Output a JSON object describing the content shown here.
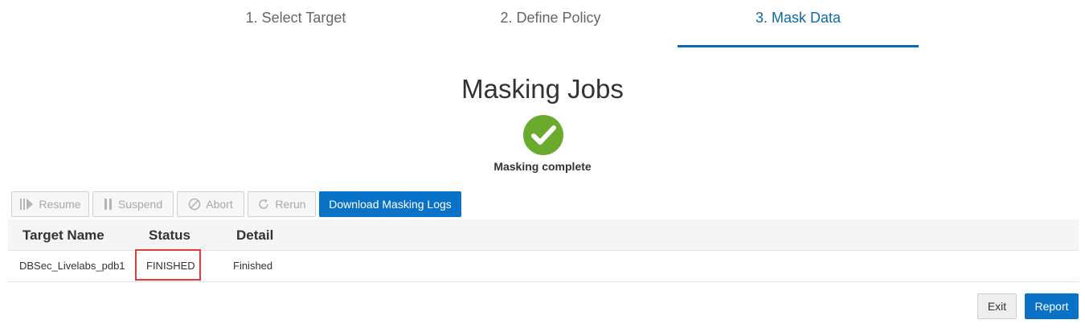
{
  "steps": [
    {
      "label": "1. Select Target"
    },
    {
      "label": "2. Define Policy"
    },
    {
      "label": "3. Mask Data"
    }
  ],
  "title": "Masking Jobs",
  "status_icon": "check-circle-icon",
  "status_text": "Masking complete",
  "toolbar": {
    "resume": "Resume",
    "suspend": "Suspend",
    "abort": "Abort",
    "rerun": "Rerun",
    "download": "Download Masking Logs"
  },
  "table": {
    "headers": [
      "Target Name",
      "Status",
      "Detail"
    ],
    "rows": [
      [
        "DBSec_Livelabs_pdb1",
        "FINISHED",
        "Finished"
      ]
    ]
  },
  "footer": {
    "exit": "Exit",
    "report": "Report"
  },
  "colors": {
    "accent": "#0a72c6",
    "success": "#6aab2e",
    "highlight": "#e03a3a"
  }
}
